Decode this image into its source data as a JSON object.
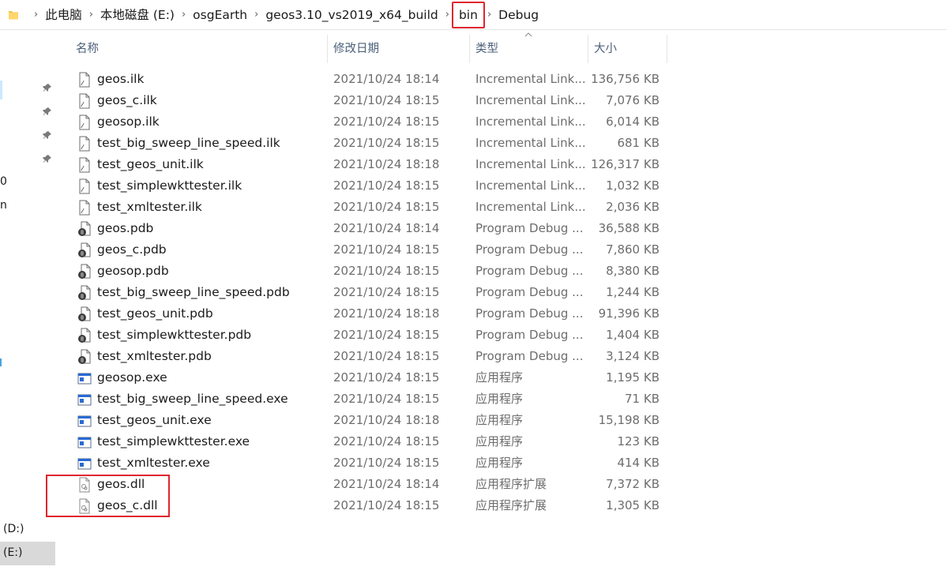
{
  "address": {
    "crumbs": [
      "此电脑",
      "本地磁盘 (E:)",
      "osgEarth",
      "geos3.10_vs2019_x64_build",
      "bin",
      "Debug"
    ]
  },
  "nav": {
    "frag1": "0",
    "frag2": "n",
    "drive_d": "(D:)",
    "drive_e": "(E:)"
  },
  "columns": {
    "name": "名称",
    "date": "修改日期",
    "type": "类型",
    "size": "大小"
  },
  "files": [
    {
      "name": "geos.ilk",
      "date": "2021/10/24 18:14",
      "type": "Incremental Link...",
      "size": "136,756 KB",
      "icon": "ilk-file-icon"
    },
    {
      "name": "geos_c.ilk",
      "date": "2021/10/24 18:15",
      "type": "Incremental Link...",
      "size": "7,076 KB",
      "icon": "ilk-file-icon"
    },
    {
      "name": "geosop.ilk",
      "date": "2021/10/24 18:15",
      "type": "Incremental Link...",
      "size": "6,014 KB",
      "icon": "ilk-file-icon"
    },
    {
      "name": "test_big_sweep_line_speed.ilk",
      "date": "2021/10/24 18:15",
      "type": "Incremental Link...",
      "size": "681 KB",
      "icon": "ilk-file-icon"
    },
    {
      "name": "test_geos_unit.ilk",
      "date": "2021/10/24 18:18",
      "type": "Incremental Link...",
      "size": "126,317 KB",
      "icon": "ilk-file-icon"
    },
    {
      "name": "test_simplewkttester.ilk",
      "date": "2021/10/24 18:15",
      "type": "Incremental Link...",
      "size": "1,032 KB",
      "icon": "ilk-file-icon"
    },
    {
      "name": "test_xmltester.ilk",
      "date": "2021/10/24 18:15",
      "type": "Incremental Link...",
      "size": "2,036 KB",
      "icon": "ilk-file-icon"
    },
    {
      "name": "geos.pdb",
      "date": "2021/10/24 18:14",
      "type": "Program Debug ...",
      "size": "36,588 KB",
      "icon": "pdb-file-icon"
    },
    {
      "name": "geos_c.pdb",
      "date": "2021/10/24 18:15",
      "type": "Program Debug ...",
      "size": "7,860 KB",
      "icon": "pdb-file-icon"
    },
    {
      "name": "geosop.pdb",
      "date": "2021/10/24 18:15",
      "type": "Program Debug ...",
      "size": "8,380 KB",
      "icon": "pdb-file-icon"
    },
    {
      "name": "test_big_sweep_line_speed.pdb",
      "date": "2021/10/24 18:15",
      "type": "Program Debug ...",
      "size": "1,244 KB",
      "icon": "pdb-file-icon"
    },
    {
      "name": "test_geos_unit.pdb",
      "date": "2021/10/24 18:18",
      "type": "Program Debug ...",
      "size": "91,396 KB",
      "icon": "pdb-file-icon"
    },
    {
      "name": "test_simplewkttester.pdb",
      "date": "2021/10/24 18:15",
      "type": "Program Debug ...",
      "size": "1,404 KB",
      "icon": "pdb-file-icon"
    },
    {
      "name": "test_xmltester.pdb",
      "date": "2021/10/24 18:15",
      "type": "Program Debug ...",
      "size": "3,124 KB",
      "icon": "pdb-file-icon"
    },
    {
      "name": "geosop.exe",
      "date": "2021/10/24 18:15",
      "type": "应用程序",
      "size": "1,195 KB",
      "icon": "exe-file-icon"
    },
    {
      "name": "test_big_sweep_line_speed.exe",
      "date": "2021/10/24 18:15",
      "type": "应用程序",
      "size": "71 KB",
      "icon": "exe-file-icon"
    },
    {
      "name": "test_geos_unit.exe",
      "date": "2021/10/24 18:18",
      "type": "应用程序",
      "size": "15,198 KB",
      "icon": "exe-file-icon"
    },
    {
      "name": "test_simplewkttester.exe",
      "date": "2021/10/24 18:15",
      "type": "应用程序",
      "size": "123 KB",
      "icon": "exe-file-icon"
    },
    {
      "name": "test_xmltester.exe",
      "date": "2021/10/24 18:15",
      "type": "应用程序",
      "size": "414 KB",
      "icon": "exe-file-icon"
    },
    {
      "name": "geos.dll",
      "date": "2021/10/24 18:14",
      "type": "应用程序扩展",
      "size": "7,372 KB",
      "icon": "dll-file-icon"
    },
    {
      "name": "geos_c.dll",
      "date": "2021/10/24 18:15",
      "type": "应用程序扩展",
      "size": "1,305 KB",
      "icon": "dll-file-icon"
    }
  ],
  "colors": {
    "highlight_box": "#e0262e",
    "header_text": "#4c607a",
    "secondary_text": "#6d6d6d"
  }
}
